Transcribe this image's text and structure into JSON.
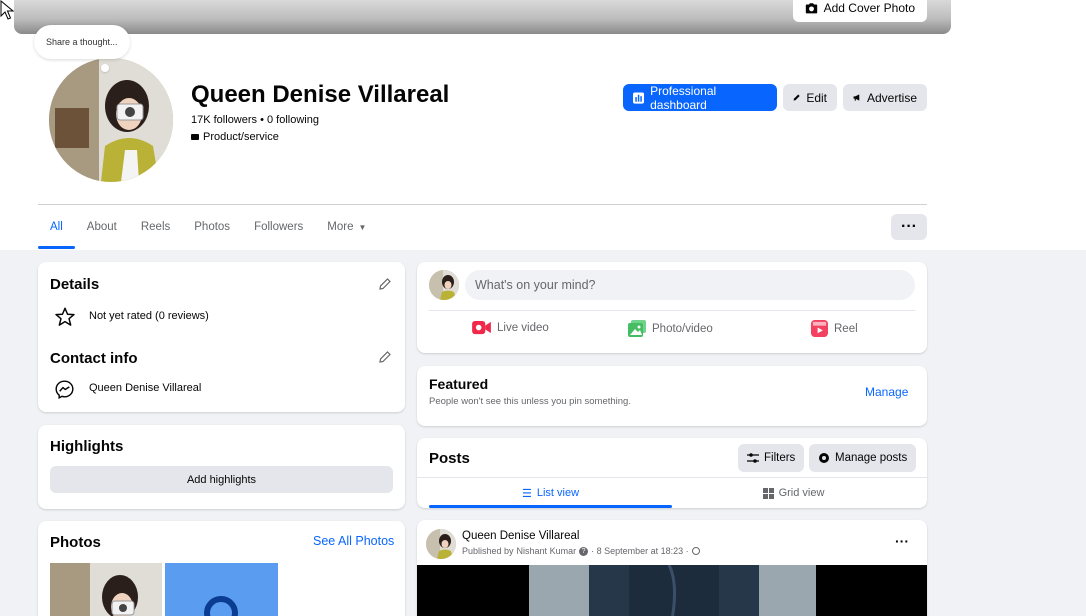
{
  "cover": {
    "add_cover_label": "Add Cover Photo"
  },
  "thought": {
    "placeholder": "Share a thought..."
  },
  "profile": {
    "name": "Queen Denise Villareal",
    "followers_line": "17K followers • 0 following",
    "category": "Product/service"
  },
  "actions": {
    "dashboard_label": "Professional dashboard",
    "edit_label": "Edit",
    "advertise_label": "Advertise"
  },
  "tabs": [
    {
      "label": "All"
    },
    {
      "label": "About"
    },
    {
      "label": "Reels"
    },
    {
      "label": "Photos"
    },
    {
      "label": "Followers"
    },
    {
      "label": "More"
    }
  ],
  "details": {
    "title": "Details",
    "rating": "Not yet rated (0 reviews)",
    "contact_title": "Contact info",
    "contact_name": "Queen Denise Villareal"
  },
  "highlights": {
    "title": "Highlights",
    "add_label": "Add highlights"
  },
  "photos": {
    "title": "Photos",
    "see_all": "See All Photos"
  },
  "composer": {
    "placeholder": "What's on your mind?",
    "live": "Live video",
    "photo": "Photo/video",
    "reel": "Reel"
  },
  "featured": {
    "title": "Featured",
    "subtitle": "People won't see this unless you pin something.",
    "manage": "Manage"
  },
  "posts": {
    "title": "Posts",
    "filters": "Filters",
    "manage": "Manage posts",
    "list_view": "List view",
    "grid_view": "Grid view"
  },
  "post": {
    "author": "Queen Denise Villareal",
    "published_prefix": "Published by",
    "publisher": "Nishant Kumar",
    "date": "· 8 September at 18:23 ·"
  },
  "colors": {
    "accent": "#0866ff",
    "background": "#f0f2f5",
    "button_grey": "#e4e6eb"
  }
}
